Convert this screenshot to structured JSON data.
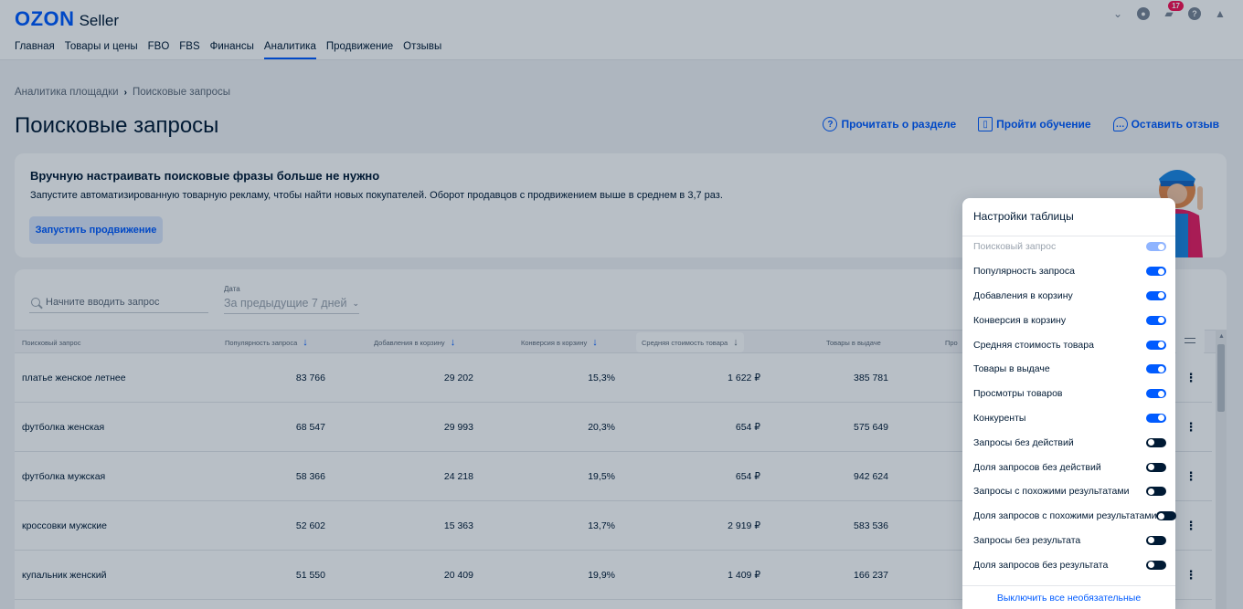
{
  "header": {
    "logo_ozon": "OZON",
    "logo_seller": "Seller",
    "notifications_count": "17",
    "nav": [
      {
        "label": "Главная",
        "active": false
      },
      {
        "label": "Товары и цены",
        "active": false
      },
      {
        "label": "FBO",
        "active": false
      },
      {
        "label": "FBS",
        "active": false
      },
      {
        "label": "Финансы",
        "active": false
      },
      {
        "label": "Аналитика",
        "active": true
      },
      {
        "label": "Продвижение",
        "active": false
      },
      {
        "label": "Отзывы",
        "active": false
      }
    ],
    "icons": [
      "chevron-down-icon",
      "user-icon",
      "chat-icon",
      "help-icon",
      "graduation-cap-icon"
    ]
  },
  "breadcrumb": {
    "parent": "Аналитика площадки",
    "current": "Поисковые запросы"
  },
  "page": {
    "title": "Поисковые запросы",
    "links": {
      "read": "Прочитать о разделе",
      "training": "Пройти обучение",
      "feedback": "Оставить отзыв"
    }
  },
  "promo": {
    "title": "Вручную настраивать поисковые фразы больше не нужно",
    "text": "Запустите автоматизированную товарную рекламу, чтобы найти новых покупателей. Оборот продавцов с продвижением выше в среднем в 3,7 раз.",
    "button": "Запустить продвижение"
  },
  "filters": {
    "search_placeholder": "Начните вводить запрос",
    "date_label": "Дата",
    "date_value": "За предыдущие 7 дней"
  },
  "table": {
    "headers": {
      "query": "Поисковый запрос",
      "popularity": "Популярность запроса",
      "add_to_cart": "Добавления в корзину",
      "conversion": "Конверсия в корзину",
      "avg_price": "Средняя стоимость товара",
      "items": "Товары в выдаче",
      "views_partial": "Про"
    },
    "rows": [
      {
        "query": "платье женское летнее",
        "popularity": "83 766",
        "add_to_cart": "29 202",
        "conversion": "15,3%",
        "avg_price": "1 622 ₽",
        "items": "385 781"
      },
      {
        "query": "футболка женская",
        "popularity": "68 547",
        "add_to_cart": "29 993",
        "conversion": "20,3%",
        "avg_price": "654 ₽",
        "items": "575 649"
      },
      {
        "query": "футболка мужская",
        "popularity": "58 366",
        "add_to_cart": "24 218",
        "conversion": "19,5%",
        "avg_price": "654 ₽",
        "items": "942 624"
      },
      {
        "query": "кроссовки мужские",
        "popularity": "52 602",
        "add_to_cart": "15 363",
        "conversion": "13,7%",
        "avg_price": "2 919 ₽",
        "items": "583 536"
      },
      {
        "query": "купальник женский",
        "popularity": "51 550",
        "add_to_cart": "20 409",
        "conversion": "19,9%",
        "avg_price": "1 409 ₽",
        "items": "166 237"
      }
    ]
  },
  "settings": {
    "title": "Настройки таблицы",
    "items": [
      {
        "label": "Поисковый запрос",
        "on": true,
        "disabled": true
      },
      {
        "label": "Популярность запроса",
        "on": true,
        "disabled": false
      },
      {
        "label": "Добавления в корзину",
        "on": true,
        "disabled": false
      },
      {
        "label": "Конверсия в корзину",
        "on": true,
        "disabled": false
      },
      {
        "label": "Средняя стоимость товара",
        "on": true,
        "disabled": false
      },
      {
        "label": "Товары в выдаче",
        "on": true,
        "disabled": false
      },
      {
        "label": "Просмотры товаров",
        "on": true,
        "disabled": false
      },
      {
        "label": "Конкуренты",
        "on": true,
        "disabled": false
      },
      {
        "label": "Запросы без действий",
        "on": false,
        "disabled": false
      },
      {
        "label": "Доля запросов без действий",
        "on": false,
        "disabled": false
      },
      {
        "label": "Запросы с похожими результатами",
        "on": false,
        "disabled": false
      },
      {
        "label": "Доля запросов с похожими результатами",
        "on": false,
        "disabled": false
      },
      {
        "label": "Запросы без результата",
        "on": false,
        "disabled": false
      },
      {
        "label": "Доля запросов без результата",
        "on": false,
        "disabled": false
      }
    ],
    "footer": "Выключить все необязательные"
  },
  "colors": {
    "accent": "#005bff",
    "text": "#001a34",
    "badge": "#f91155"
  }
}
